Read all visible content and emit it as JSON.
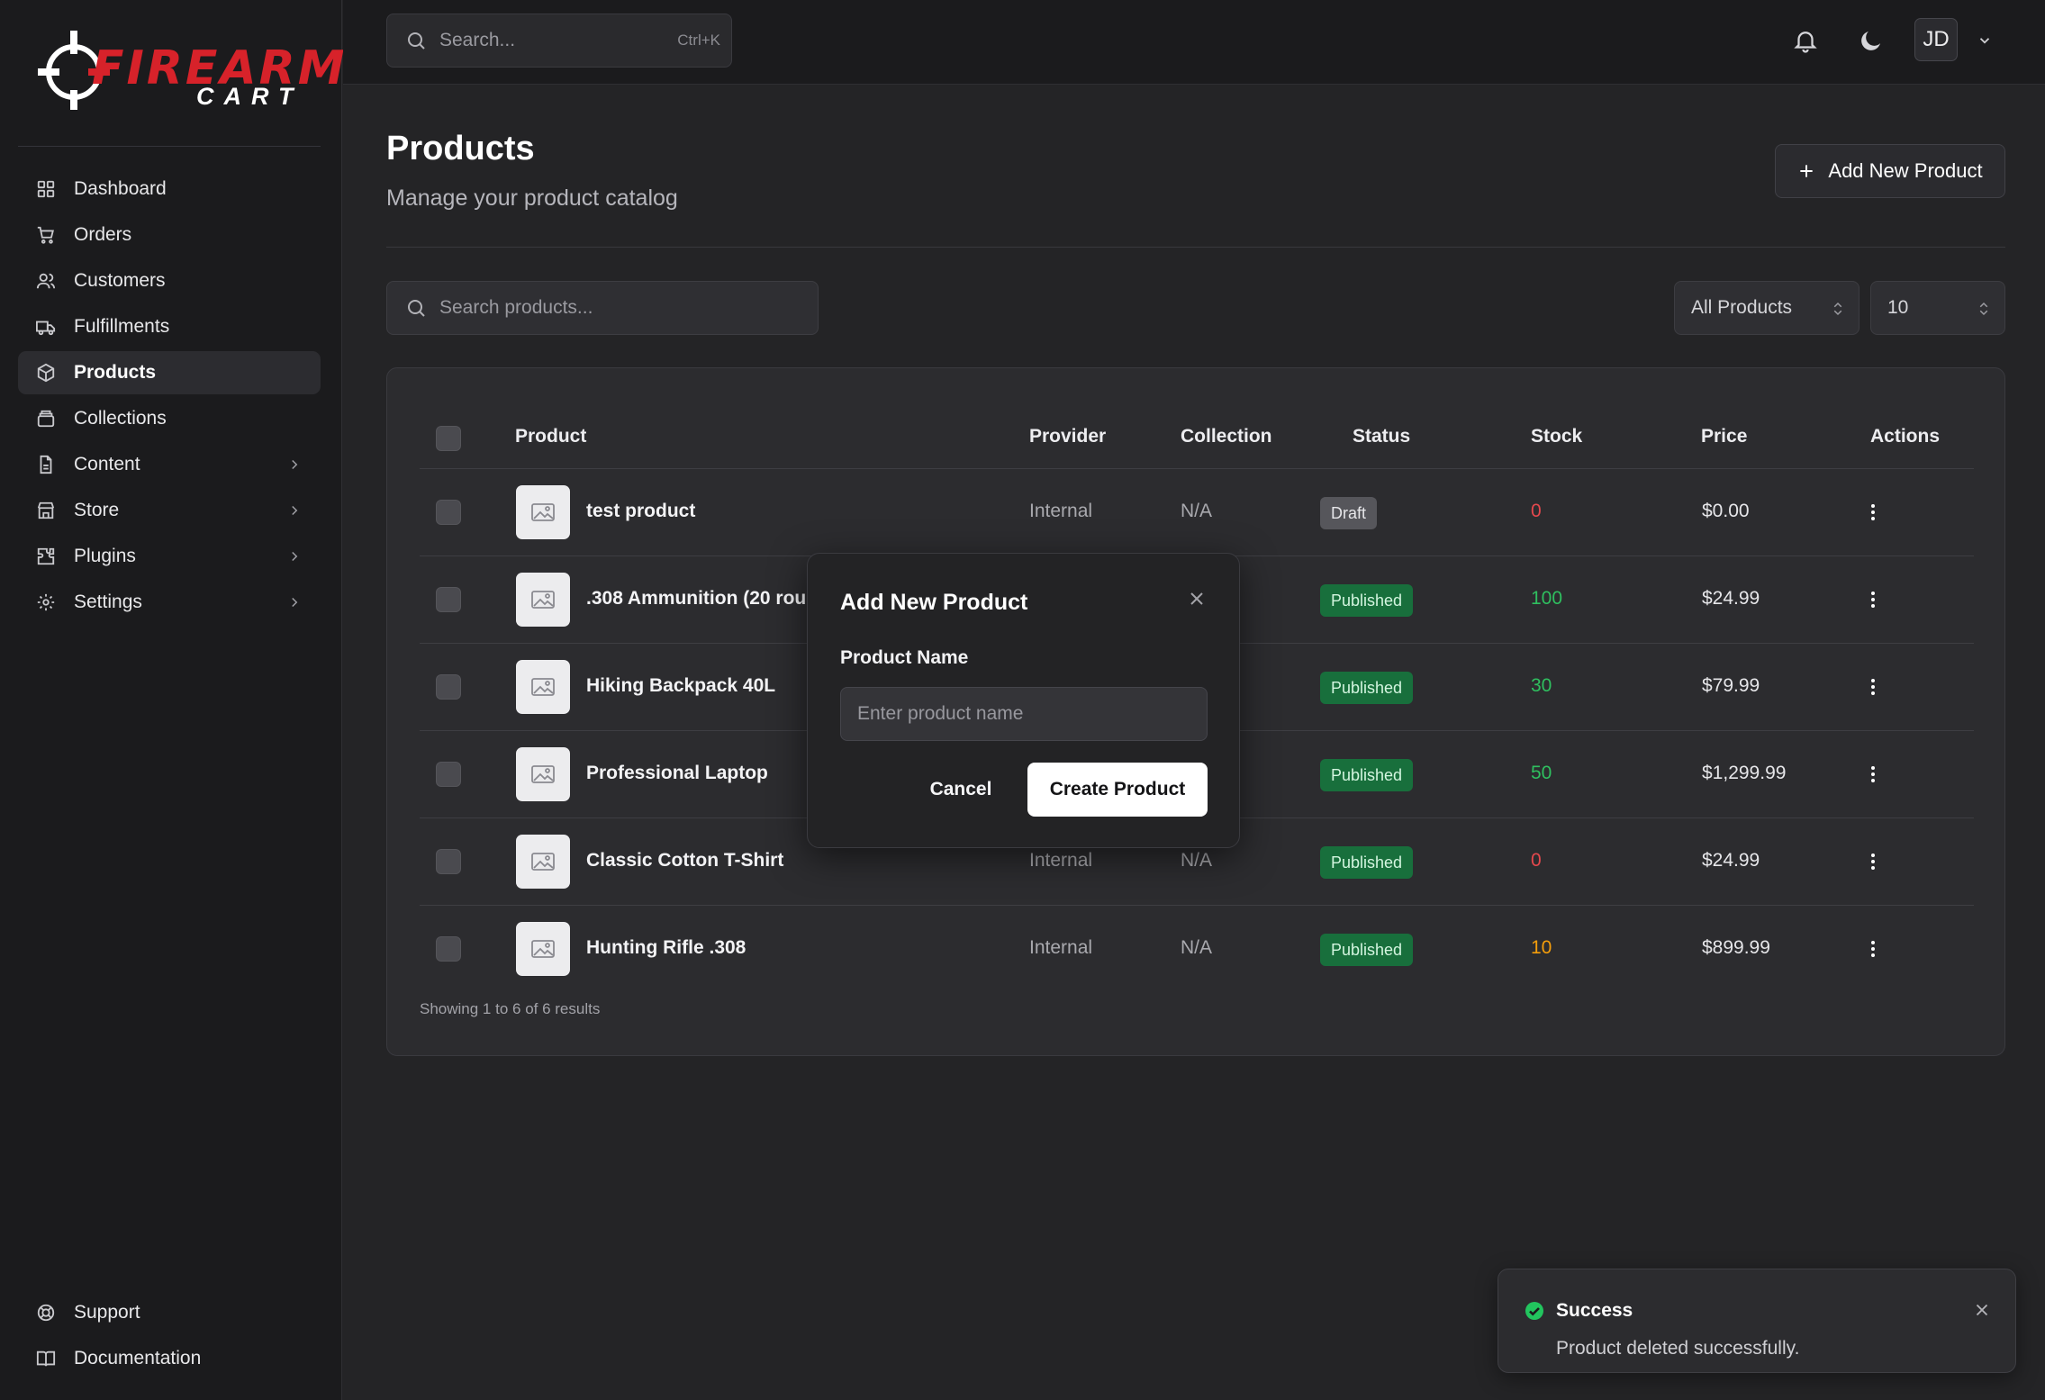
{
  "brand": {
    "logo_line1": "FIREARM",
    "logo_line2": "CART",
    "accent": "#d7222a"
  },
  "sidebar": {
    "items": [
      {
        "label": "Dashboard",
        "icon": "grid-icon"
      },
      {
        "label": "Orders",
        "icon": "cart-icon"
      },
      {
        "label": "Customers",
        "icon": "users-icon"
      },
      {
        "label": "Fulfillments",
        "icon": "truck-icon"
      },
      {
        "label": "Products",
        "icon": "box-icon",
        "active": true
      },
      {
        "label": "Collections",
        "icon": "layers-icon"
      },
      {
        "label": "Content",
        "icon": "file-icon",
        "expandable": true
      },
      {
        "label": "Store",
        "icon": "store-icon",
        "expandable": true
      },
      {
        "label": "Plugins",
        "icon": "puzzle-icon",
        "expandable": true
      },
      {
        "label": "Settings",
        "icon": "gear-icon",
        "expandable": true
      }
    ],
    "bottom": [
      {
        "label": "Support",
        "icon": "lifebuoy-icon"
      },
      {
        "label": "Documentation",
        "icon": "book-icon"
      }
    ]
  },
  "header": {
    "search_placeholder": "Search...",
    "search_shortcut": "Ctrl+K",
    "avatar_initials": "JD"
  },
  "page": {
    "title": "Products",
    "subtitle": "Manage your product catalog",
    "add_button": "Add New Product",
    "search_placeholder": "Search products...",
    "filter_value": "All Products",
    "page_size": "10"
  },
  "table": {
    "columns": [
      "Product",
      "Provider",
      "Collection",
      "Status",
      "Stock",
      "Price",
      "Actions"
    ],
    "rows": [
      {
        "name": "test product",
        "provider": "Internal",
        "collection": "N/A",
        "status": "Draft",
        "stock": "0",
        "stock_color": "#e5484d",
        "price": "$0.00"
      },
      {
        "name": ".308 Ammunition (20 rou",
        "provider": "",
        "collection": "",
        "status": "Published",
        "stock": "100",
        "stock_color": "#2fbf5f",
        "price": "$24.99"
      },
      {
        "name": "Hiking Backpack 40L",
        "provider": "",
        "collection": "",
        "status": "Published",
        "stock": "30",
        "stock_color": "#2fbf5f",
        "price": "$79.99"
      },
      {
        "name": "Professional Laptop",
        "provider": "",
        "collection": "",
        "status": "Published",
        "stock": "50",
        "stock_color": "#2fbf5f",
        "price": "$1,299.99"
      },
      {
        "name": "Classic Cotton T-Shirt",
        "provider": "Internal",
        "collection": "N/A",
        "status": "Published",
        "stock": "0",
        "stock_color": "#e5484d",
        "price": "$24.99"
      },
      {
        "name": "Hunting Rifle .308",
        "provider": "Internal",
        "collection": "N/A",
        "status": "Published",
        "stock": "10",
        "stock_color": "#f59e0b",
        "price": "$899.99"
      }
    ],
    "footer": "Showing 1 to 6 of 6 results"
  },
  "modal": {
    "title": "Add New Product",
    "field_label": "Product Name",
    "field_placeholder": "Enter product name",
    "cancel": "Cancel",
    "submit": "Create Product"
  },
  "toast": {
    "title": "Success",
    "message": "Product deleted successfully.",
    "color": "#22c55e"
  }
}
